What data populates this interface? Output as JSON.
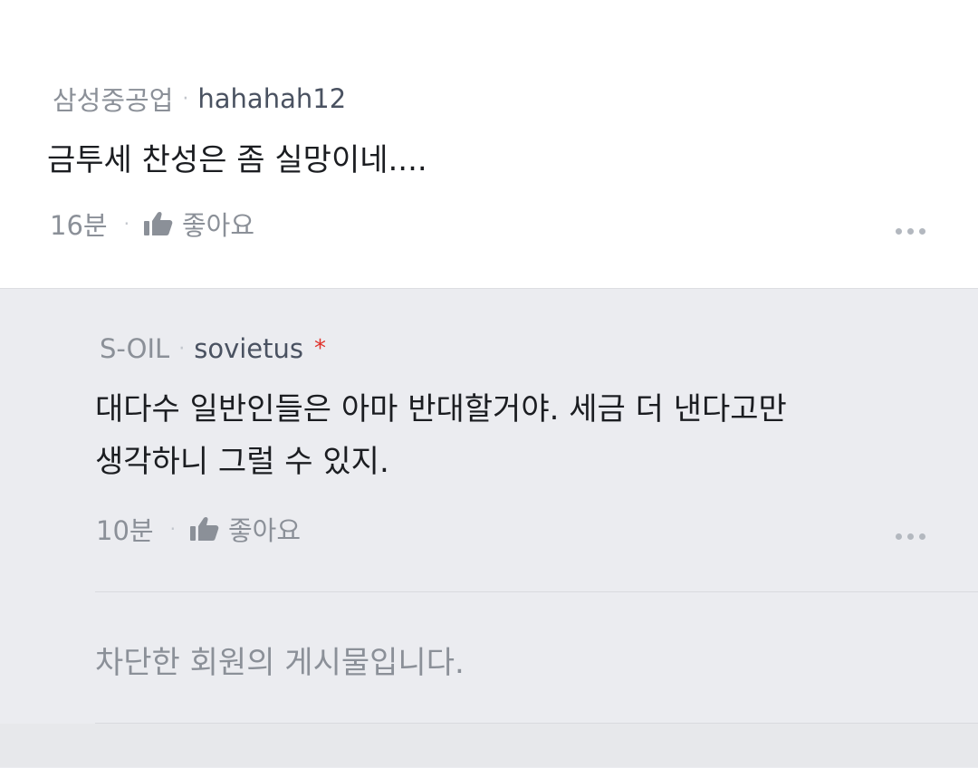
{
  "comments": [
    {
      "company": "삼성중공업",
      "nickname": "hahahah12",
      "text_lines": [
        "금투세 찬성은 좀 실망이네...."
      ],
      "time": "16분",
      "like_label": "좋아요"
    },
    {
      "company": "S-OIL",
      "nickname": "sovietus",
      "badge": "*",
      "text_lines": [
        "대다수 일반인들은 아마 반대할거야. 세금 더 낸다고만",
        "생각하니 그럴 수 있지."
      ],
      "time": "10분",
      "like_label": "좋아요"
    }
  ],
  "blocked_notice": "차단한 회원의 게시물입니다.",
  "icons": {
    "like": "thumbs-up-icon",
    "more": "more-dots-icon"
  },
  "colors": {
    "meta_gray": "#8b9098",
    "nickname": "#4a5261",
    "badge_red": "#e0322a",
    "reply_bg": "#ebecf0"
  }
}
